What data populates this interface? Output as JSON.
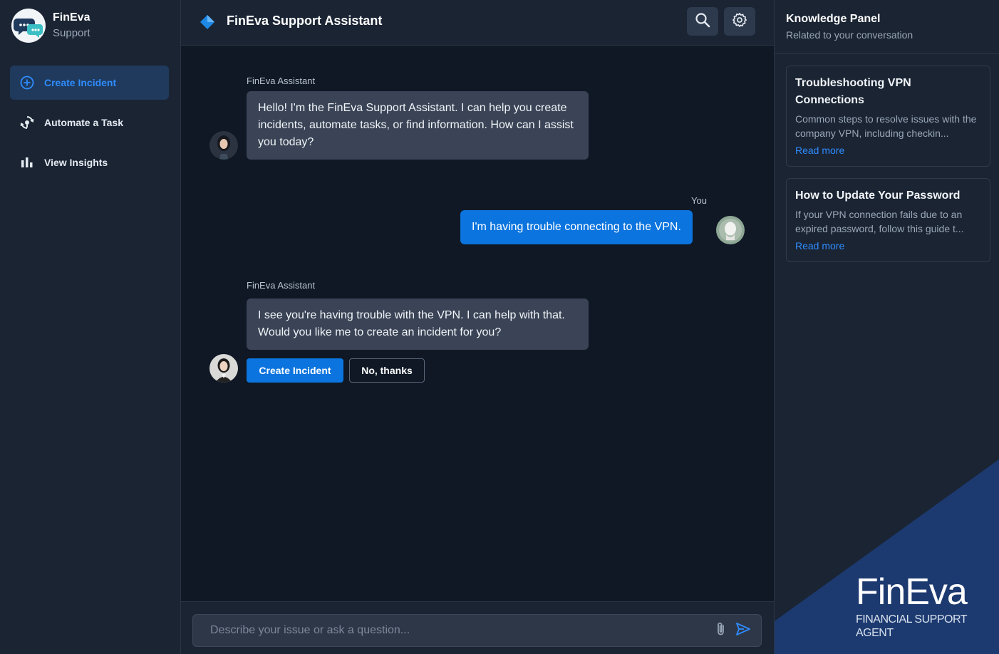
{
  "brand": {
    "name": "FinEva",
    "subtitle": "Support"
  },
  "sidebar": {
    "items": [
      {
        "label": "Create Incident",
        "icon": "plus-circle-icon",
        "active": true
      },
      {
        "label": "Automate a Task",
        "icon": "automation-icon",
        "active": false
      },
      {
        "label": "View Insights",
        "icon": "bar-chart-icon",
        "active": false
      }
    ]
  },
  "header": {
    "title": "FinEva Support Assistant"
  },
  "chat": {
    "messages": [
      {
        "sender": "FinEva Assistant",
        "text": "Hello! I'm the FinEva Support Assistant. I can help you create incidents, automate tasks, or find information. How can I assist you today?"
      },
      {
        "sender": "You",
        "text": "I'm having trouble connecting to the VPN."
      },
      {
        "sender": "FinEva Assistant",
        "text": "I see you're having trouble with the VPN. I can help with that. Would you like me to create an incident for you?"
      }
    ],
    "actions": {
      "primary": "Create Incident",
      "secondary": "No, thanks"
    }
  },
  "composer": {
    "placeholder": "Describe your issue or ask a question..."
  },
  "knowledge": {
    "title": "Knowledge Panel",
    "subtitle": "Related to your conversation",
    "cards": [
      {
        "title": "Troubleshooting VPN Connections",
        "desc": "Common steps to resolve issues with the company VPN, including checkin...",
        "link": "Read more"
      },
      {
        "title": "How to Update Your Password",
        "desc": "If your VPN connection fails due to an expired password, follow this guide t...",
        "link": "Read more"
      }
    ]
  },
  "watermark": {
    "brand": "FinEva",
    "line1": "FINANCIAL SUPPORT",
    "line2": "AGENT"
  },
  "colors": {
    "accent": "#0b74de",
    "link": "#2f8cff",
    "background": "#0f1824",
    "panel": "#1a2433"
  }
}
